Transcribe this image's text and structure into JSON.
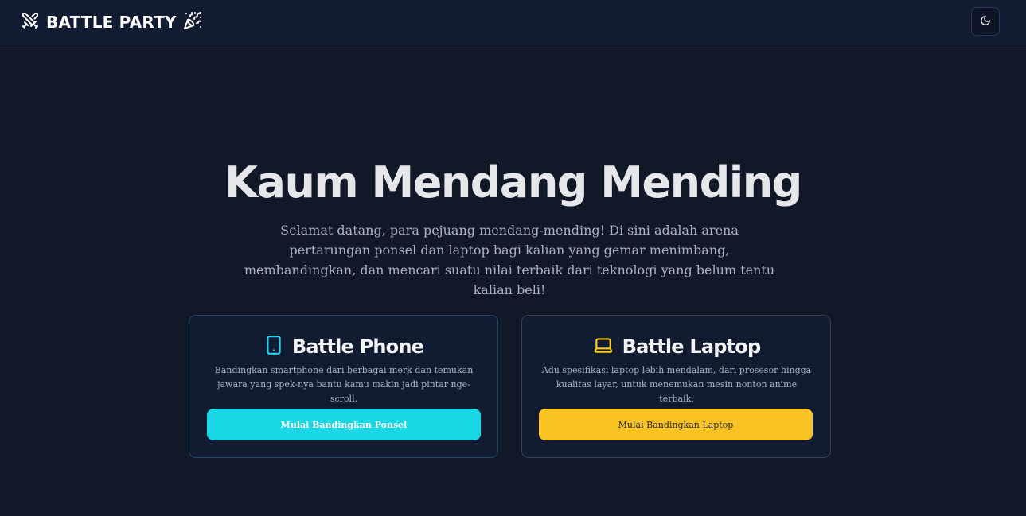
{
  "header": {
    "brand": "BATTLE PARTY",
    "brand_icon": "swords-icon",
    "party_icon": "party-popper-icon",
    "theme_toggle_icon": "moon-icon"
  },
  "hero": {
    "title": "Kaum Mendang Mending",
    "subtitle": "Selamat datang, para pejuang mendang-mending! Di sini adalah arena pertarungan ponsel dan laptop bagi kalian yang gemar menimbang, membandingkan, dan mencari suatu nilai terbaik dari teknologi yang belum tentu kalian beli!"
  },
  "cards": {
    "phone": {
      "icon": "smartphone-icon",
      "title": "Battle Phone",
      "description": "Bandingkan smartphone dari berbagai merk dan temukan jawara yang spek-nya bantu kamu makin jadi pintar nge-scroll.",
      "button_label": "Mulai Bandingkan Ponsel",
      "accent": "#1ad7e6"
    },
    "laptop": {
      "icon": "laptop-icon",
      "title": "Battle Laptop",
      "description": "Adu spesifikasi laptop lebih mendalam, dari prosesor hingga kualitas layar, untuk menemukan mesin nonton anime terbaik.",
      "button_label": "Mulai Bandingkan Laptop",
      "accent": "#f9c223"
    }
  },
  "colors": {
    "background": "#111827",
    "header": "#111c33"
  }
}
